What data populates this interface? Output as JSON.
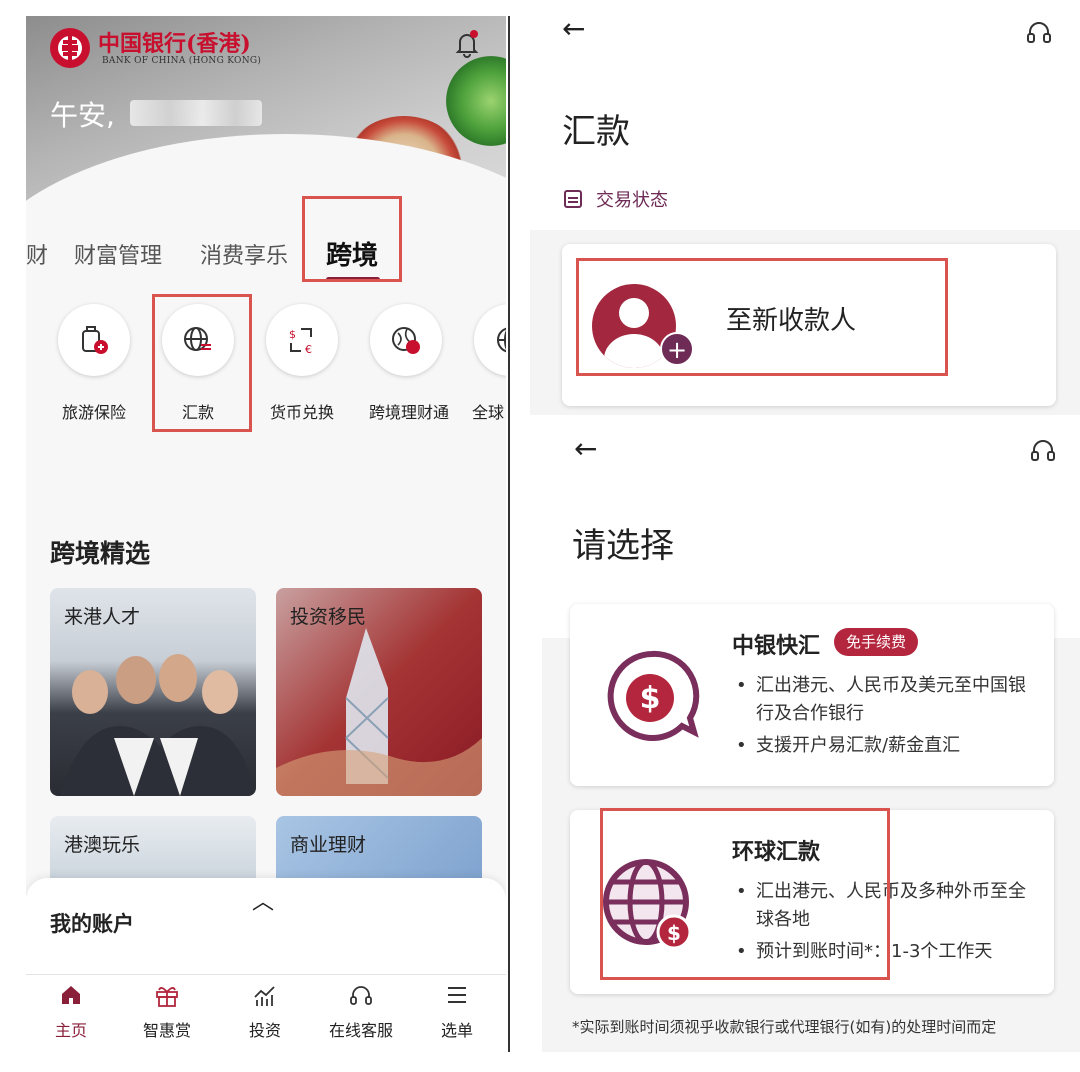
{
  "left": {
    "logo_cn": "中国银行(香港)",
    "logo_en": "BANK OF CHINA (HONG KONG)",
    "greeting": "午安,",
    "tabs": [
      "财",
      "财富管理",
      "消费享乐",
      "跨境"
    ],
    "active_tab": "跨境",
    "services": [
      {
        "label": "旅游保险",
        "icon": "luggage-icon"
      },
      {
        "label": "汇款",
        "icon": "globe-transfer-icon"
      },
      {
        "label": "货币兑换",
        "icon": "currency-exchange-icon"
      },
      {
        "label": "跨境理财通",
        "icon": "globe-money-icon"
      },
      {
        "label": "全球",
        "icon": "globe-icon"
      }
    ],
    "section_title": "跨境精选",
    "featured": [
      "来港人才",
      "投资移民",
      "港澳玩乐",
      "商业理财"
    ],
    "account_title": "我的账户",
    "nav": [
      {
        "label": "主页",
        "icon": "home-icon"
      },
      {
        "label": "智惠赏",
        "icon": "gift-icon"
      },
      {
        "label": "投资",
        "icon": "chart-icon"
      },
      {
        "label": "在线客服",
        "icon": "headset-icon"
      },
      {
        "label": "选单",
        "icon": "menu-icon"
      }
    ]
  },
  "remit": {
    "title": "汇款",
    "status_label": "交易状态",
    "new_payee": "至新收款人"
  },
  "choose": {
    "title": "请选择",
    "options": [
      {
        "title": "中银快汇",
        "badge": "免手续费",
        "bullets": [
          "汇出港元、人民币及美元至中国银行及合作银行",
          "支援开户易汇款/薪金直汇"
        ]
      },
      {
        "title": "环球汇款",
        "bullets": [
          "汇出港元、人民币及多种外币至全球各地",
          "预计到账时间*：1-3个工作天"
        ]
      }
    ],
    "footnote": "*实际到账时间须视乎收款银行或代理银行(如有)的处理时间而定"
  },
  "colors": {
    "brand": "#c8102e",
    "accent": "#8a1f3a",
    "purple": "#6d2b55",
    "highlight": "#d9534f"
  }
}
